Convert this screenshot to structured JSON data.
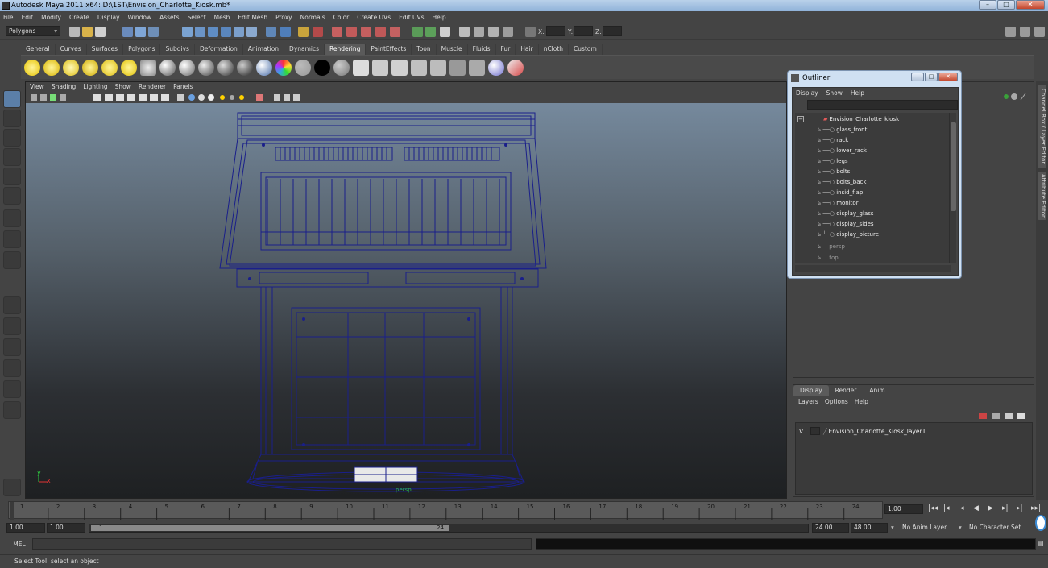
{
  "window": {
    "title": "Autodesk Maya 2011 x64: D:\\1ST\\Envision_Charlotte_Kiosk.mb*"
  },
  "menubar": [
    "File",
    "Edit",
    "Modify",
    "Create",
    "Display",
    "Window",
    "Assets",
    "Select",
    "Mesh",
    "Edit Mesh",
    "Proxy",
    "Normals",
    "Color",
    "Create UVs",
    "Edit UVs",
    "Help"
  ],
  "statusline": {
    "menuset": "Polygons",
    "x_label": "X:",
    "y_label": "Y:",
    "z_label": "Z:"
  },
  "shelf_tabs": [
    "General",
    "Curves",
    "Surfaces",
    "Polygons",
    "Subdivs",
    "Deformation",
    "Animation",
    "Dynamics",
    "Rendering",
    "PaintEffects",
    "Toon",
    "Muscle",
    "Fluids",
    "Fur",
    "Hair",
    "nCloth",
    "Custom"
  ],
  "shelf_active": "Rendering",
  "viewport": {
    "menu": [
      "View",
      "Shading",
      "Lighting",
      "Show",
      "Renderer",
      "Panels"
    ],
    "camera_label": "persp",
    "axis_y": "y",
    "axis_x": "x",
    "wire_color": "#1a1f8a"
  },
  "outliner": {
    "title": "Outliner",
    "menu": [
      "Display",
      "Show",
      "Help"
    ],
    "root": "Envision_Charlotte_kiosk",
    "children": [
      "glass_front",
      "rack",
      "lower_rack",
      "legs",
      "bolts",
      "bolts_back",
      "insid_flap",
      "monitor",
      "display_glass",
      "display_sides",
      "display_picture"
    ],
    "cameras": [
      "persp",
      "top"
    ]
  },
  "side_tabs": [
    "Channel Box / Layer Editor",
    "Attribute Editor"
  ],
  "layer_editor": {
    "tabs": [
      "Display",
      "Render",
      "Anim"
    ],
    "active_tab": "Display",
    "menu": [
      "Layers",
      "Options",
      "Help"
    ],
    "layers": [
      {
        "visible": "V",
        "name": "Envision_Charlotte_Kiosk_layer1"
      }
    ]
  },
  "timeslider": {
    "start_tick": "1",
    "ticks": [
      "2",
      "3",
      "4",
      "5",
      "6",
      "7",
      "8",
      "9",
      "10",
      "11",
      "12",
      "13",
      "14",
      "15",
      "16",
      "17",
      "18",
      "19",
      "20",
      "21",
      "22",
      "23",
      "24"
    ],
    "current_frame": "1.00"
  },
  "rangeslider": {
    "start": "1.00",
    "playback_start": "1.00",
    "range_left": "1",
    "range_right": "24",
    "playback_end": "24.00",
    "end": "48.00",
    "anim_layer": "No Anim Layer",
    "character_set": "No Character Set"
  },
  "command": {
    "label": "MEL"
  },
  "helpline": "Select Tool: select an object"
}
